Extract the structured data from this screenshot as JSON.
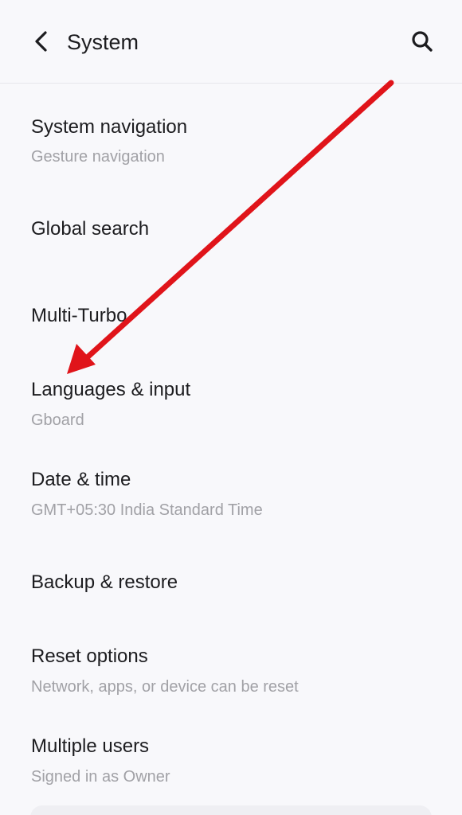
{
  "header": {
    "title": "System",
    "back_icon": "chevron-left-icon",
    "search_icon": "search-icon"
  },
  "items": [
    {
      "label": "System navigation",
      "sub": "Gesture navigation"
    },
    {
      "label": "Global search",
      "sub": ""
    },
    {
      "label": "Multi-Turbo",
      "sub": ""
    },
    {
      "label": "Languages & input",
      "sub": "Gboard"
    },
    {
      "label": "Date & time",
      "sub": "GMT+05:30 India Standard Time"
    },
    {
      "label": "Backup & restore",
      "sub": ""
    },
    {
      "label": "Reset options",
      "sub": "Network, apps, or device can be reset"
    },
    {
      "label": "Multiple users",
      "sub": "Signed in as Owner"
    }
  ],
  "annotation": {
    "arrow_color": "#e0141a"
  }
}
